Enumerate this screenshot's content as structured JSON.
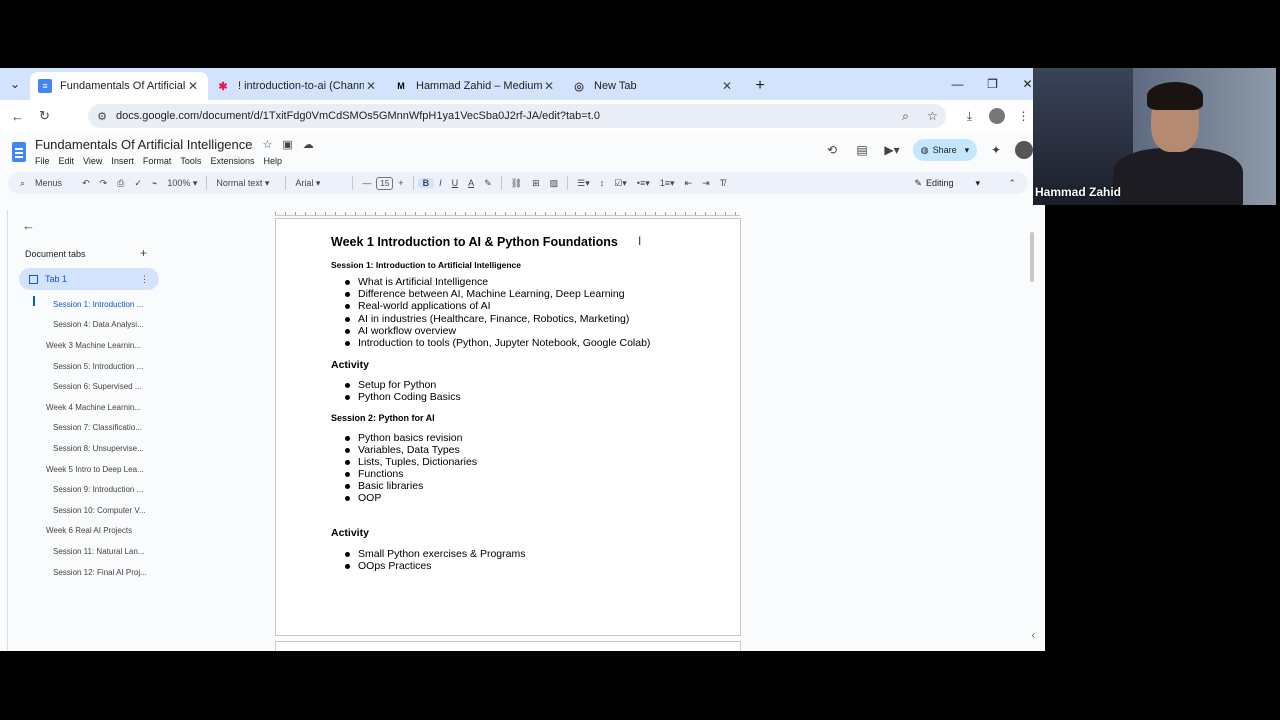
{
  "browser": {
    "tabs": [
      {
        "title": "Fundamentals Of Artificial Intelli",
        "favicon": "docs-icon",
        "active": true
      },
      {
        "title": "! introduction-to-ai (Channel) -",
        "favicon": "slack-icon",
        "active": false
      },
      {
        "title": "Hammad Zahid – Medium",
        "favicon": "M",
        "active": false
      },
      {
        "title": "New Tab",
        "favicon": "chrome-icon",
        "active": false
      }
    ],
    "url": "docs.google.com/document/d/1TxitFdg0VmCdSMOs5GMnnWfpH1ya1VecSba0J2rf-JA/edit?tab=t.0"
  },
  "docs": {
    "title": "Fundamentals Of Artificial Intelligence",
    "menu": [
      "File",
      "Edit",
      "View",
      "Insert",
      "Format",
      "Tools",
      "Extensions",
      "Help"
    ],
    "share_label": "Share",
    "toolbar": {
      "menus_label": "Menus",
      "zoom": "100%",
      "style": "Normal text",
      "font": "Arial",
      "font_size": "15",
      "mode": "Editing"
    }
  },
  "sidebar": {
    "heading": "Document tabs",
    "tab_name": "Tab 1",
    "outline": [
      {
        "label": "Session 1: Introduction ...",
        "level": "h3",
        "active": true
      },
      {
        "label": "Session 4: Data Analysi...",
        "level": "h3"
      },
      {
        "label": "Week 3 Machine Learnin...",
        "level": "h1"
      },
      {
        "label": "Session 5: Introduction ...",
        "level": "h3"
      },
      {
        "label": "Session 6: Supervised ...",
        "level": "h3"
      },
      {
        "label": "Week 4 Machine Learnin...",
        "level": "h1"
      },
      {
        "label": "Session 7: Classificatio...",
        "level": "h3"
      },
      {
        "label": "Session 8: Unsupervise...",
        "level": "h3"
      },
      {
        "label": "Week 5 Intro to Deep Lea...",
        "level": "h1"
      },
      {
        "label": "Session 9: Introduction ...",
        "level": "h3"
      },
      {
        "label": "Session 10: Computer V...",
        "level": "h3"
      },
      {
        "label": "Week 6 Real AI Projects",
        "level": "h1"
      },
      {
        "label": "Session 11: Natural Lan...",
        "level": "h3"
      },
      {
        "label": "Session 12: Final AI Proj...",
        "level": "h3"
      }
    ]
  },
  "document": {
    "week_title": "Week 1  Introduction to AI & Python Foundations",
    "session1": {
      "heading": "Session 1: Introduction to Artificial Intelligence",
      "items": [
        "What is Artificial Intelligence",
        "Difference between AI, Machine Learning, Deep Learning",
        "Real-world applications of AI",
        "AI in industries (Healthcare, Finance, Robotics, Marketing)",
        "AI workflow overview",
        "Introduction to tools (Python, Jupyter Notebook, Google Colab)"
      ]
    },
    "activity1": {
      "heading": "Activity",
      "items": [
        "Setup for Python",
        "Python Coding Basics"
      ]
    },
    "session2": {
      "heading": "Session 2: Python for AI",
      "items": [
        "Python basics revision",
        "Variables, Data Types",
        "Lists, Tuples, Dictionaries",
        "Functions",
        "Basic libraries",
        "OOP"
      ]
    },
    "activity2": {
      "heading": "Activity",
      "items": [
        "Small Python exercises & Programs",
        "OOps Practices"
      ]
    }
  },
  "webcam": {
    "name": "Hammad Zahid"
  }
}
